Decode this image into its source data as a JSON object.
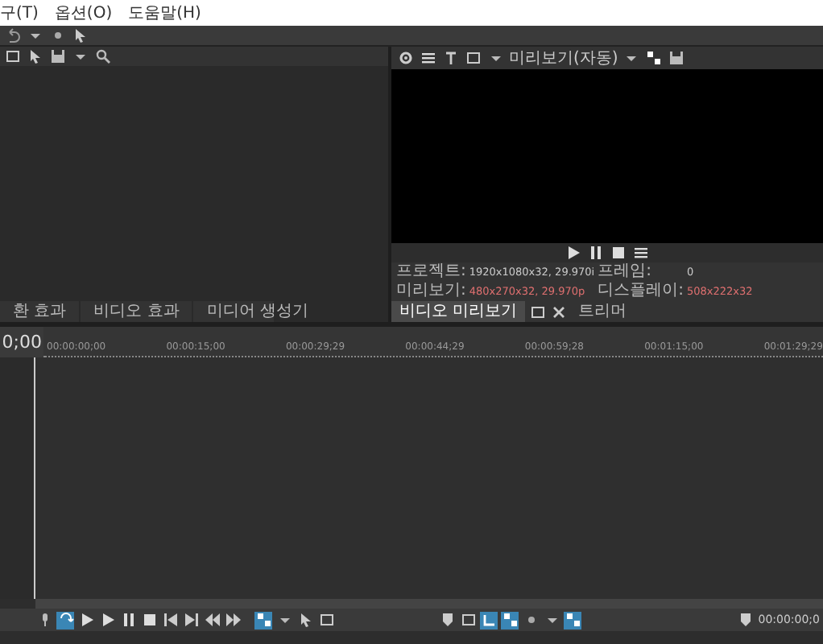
{
  "menu": [
    {
      "label": "구(T)"
    },
    {
      "label": "옵션(O)"
    },
    {
      "label": "도움말(H)"
    }
  ],
  "preview": {
    "mode": "미리보기(자동)",
    "info": [
      {
        "label": "프로젝트:",
        "value": "1920x1080x32, 29.970i",
        "highlight": false
      },
      {
        "label": "프레임:",
        "value": "0",
        "highlight": false
      },
      {
        "label": "미리보기:",
        "value": "480x270x32, 29.970p",
        "highlight": true
      },
      {
        "label": "디스플레이:",
        "value": "508x222x32",
        "highlight": true
      }
    ],
    "tabs": [
      {
        "label": "비디오 미리보기",
        "selected": true
      },
      {
        "label": "트리머",
        "selected": false
      }
    ]
  },
  "media_tabs": [
    {
      "label": "환 효과",
      "selected": false
    },
    {
      "label": "비디오 효과",
      "selected": false
    },
    {
      "label": "미디어 생성기",
      "selected": false
    }
  ],
  "timeline": {
    "time": "0;00",
    "ruler": [
      "00:00:00;00",
      "00:00:15;00",
      "00:00:29;29",
      "00:00:44;29",
      "00:00:59;28",
      "00:01:15;00",
      "00:01:29;29"
    ],
    "status_time": "00:00:00;0"
  }
}
